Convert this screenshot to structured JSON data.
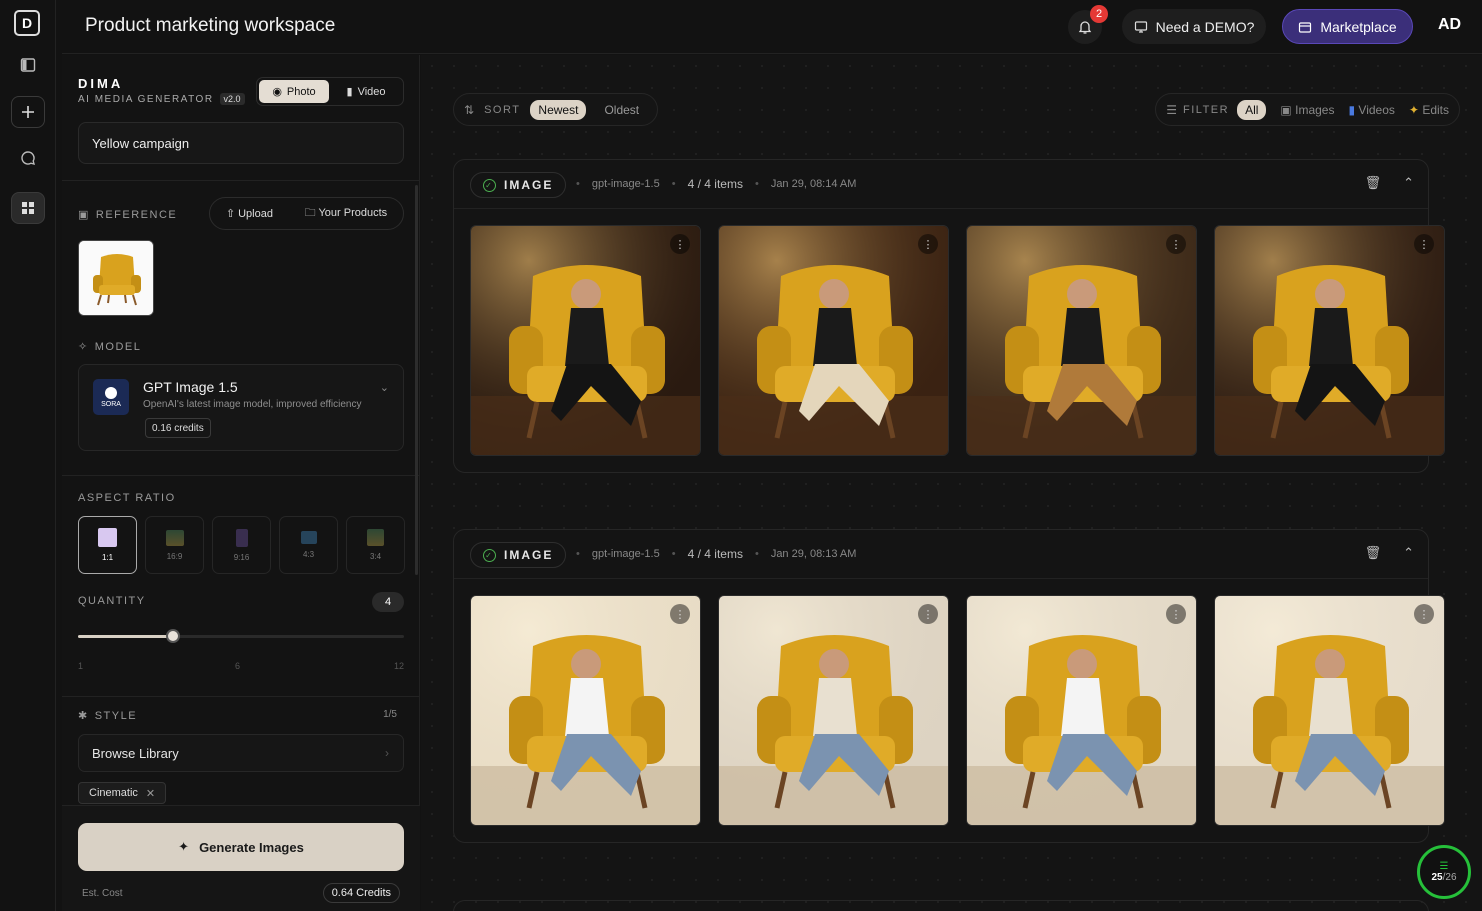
{
  "header": {
    "title": "Product marketing workspace",
    "notification_count": "2",
    "demo_label": "Need a DEMO?",
    "marketplace_label": "Marketplace",
    "avatar": "AD"
  },
  "panel": {
    "brand": "DIMA",
    "subtitle": "AI MEDIA GENERATOR",
    "version": "v2.0",
    "modes": [
      "Photo",
      "Video"
    ],
    "active_mode": "Photo",
    "project_name": "Yellow campaign",
    "reference": {
      "label": "REFERENCE",
      "upload_label": "Upload",
      "products_label": "Your Products"
    },
    "model": {
      "label": "MODEL",
      "name": "GPT Image 1.5",
      "description": "OpenAI's latest image model, improved efficiency",
      "credits": "0.16 credits",
      "logo_text": "SORA"
    },
    "aspect_ratio": {
      "label": "ASPECT RATIO",
      "options": [
        "1:1",
        "16:9",
        "9:16",
        "4:3",
        "3:4"
      ],
      "selected": "1:1"
    },
    "quantity": {
      "label": "QUANTITY",
      "value": 4,
      "display": "4",
      "min_label": "1",
      "mid_label": "6",
      "max_label": "12",
      "fraction": 0.29
    },
    "style": {
      "label": "STYLE",
      "count": "1/5",
      "browse_label": "Browse Library",
      "chips": [
        "Cinematic"
      ]
    },
    "generate_label": "Generate Images",
    "est_cost_label": "Est. Cost",
    "est_cost_value": "0.64 Credits"
  },
  "main": {
    "sort": {
      "label": "SORT",
      "options": [
        "Newest",
        "Oldest"
      ],
      "active": "Newest"
    },
    "filter": {
      "label": "FILTER",
      "options": [
        "All",
        "Images",
        "Videos",
        "Edits"
      ],
      "active": "All"
    },
    "groups": [
      {
        "type": "IMAGE",
        "model": "gpt-image-1.5",
        "items": "4 / 4 items",
        "date": "Jan 29, 08:14 AM",
        "scene": "dark"
      },
      {
        "type": "IMAGE",
        "model": "gpt-image-1.5",
        "items": "4 / 4 items",
        "date": "Jan 29, 08:13 AM",
        "scene": "bright"
      }
    ],
    "progress": {
      "done": "25",
      "total": "/26"
    }
  },
  "colors": {
    "accent_purple": "#3b2f7a",
    "generate_bg": "#d9d1c5",
    "progress_green": "#26c03a",
    "chair_yellow": "#d9a21e"
  }
}
